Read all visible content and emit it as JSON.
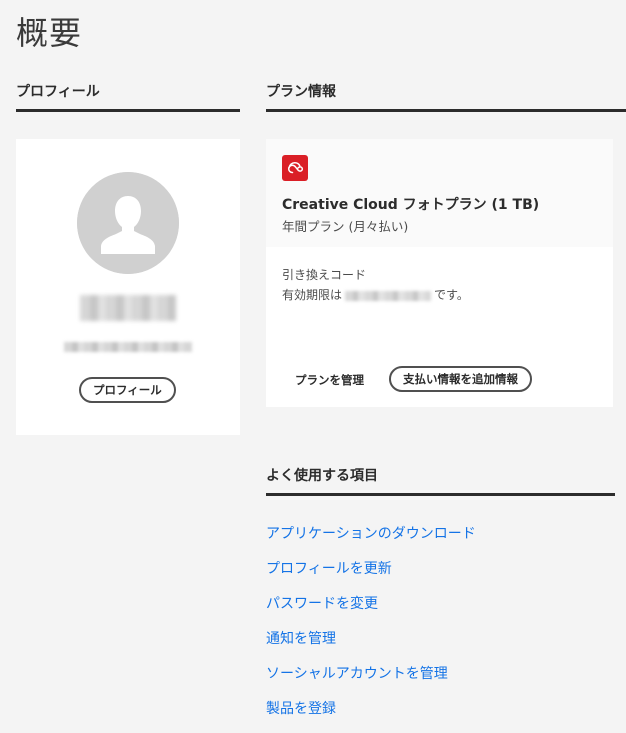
{
  "page": {
    "title": "概要"
  },
  "profile": {
    "heading": "プロフィール",
    "button_label": "プロフィール"
  },
  "plan": {
    "heading": "プラン情報",
    "logo_icon": "creative-cloud-icon",
    "name": "Creative Cloud フォトプラン (1 TB)",
    "billing": "年間プラン (月々払い)",
    "redeem_label": "引き換えコード",
    "expiry_prefix": "有効期限は",
    "expiry_suffix": "です。",
    "manage_label": "プランを管理",
    "payment_button_label": "支払い情報を追加情報"
  },
  "frequent": {
    "heading": "よく使用する項目",
    "links": [
      "アプリケーションのダウンロード",
      "プロフィールを更新",
      "パスワードを変更",
      "通知を管理",
      "ソーシャルアカウントを管理",
      "製品を登録"
    ]
  },
  "colors": {
    "background": "#f4f4f4",
    "card": "#ffffff",
    "link": "#1473e6",
    "brand_red": "#da1f26",
    "rule": "#2c2c2c"
  }
}
